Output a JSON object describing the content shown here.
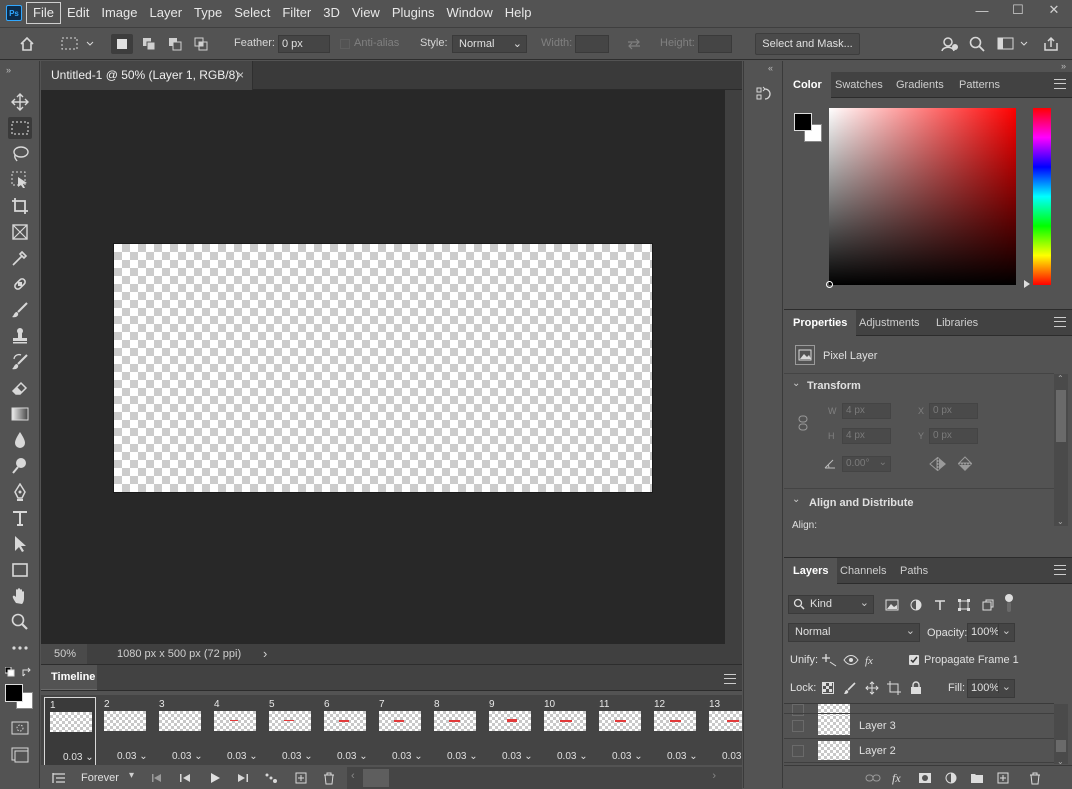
{
  "app": {
    "logo": "Ps"
  },
  "menu": [
    "File",
    "Edit",
    "Image",
    "Layer",
    "Type",
    "Select",
    "Filter",
    "3D",
    "View",
    "Plugins",
    "Window",
    "Help"
  ],
  "window_controls": {
    "minimize": "—",
    "restore": "☐",
    "close": "✕"
  },
  "options": {
    "feather_label": "Feather:",
    "feather_value": "0 px",
    "antialias_label": "Anti-alias",
    "style_label": "Style:",
    "style_value": "Normal",
    "width_label": "Width:",
    "height_label": "Height:",
    "select_mask_label": "Select and Mask..."
  },
  "document": {
    "tab_title": "Untitled-1 @ 50% (Layer 1, RGB/8)",
    "tab_close": "×",
    "zoom": "50%",
    "doc_info": "1080 px x 500 px (72 ppi)",
    "status_arrow": "›"
  },
  "timeline": {
    "title": "Timeline",
    "loop": "Forever",
    "frames": [
      {
        "num": "1",
        "delay": "0.03"
      },
      {
        "num": "2",
        "delay": "0.03"
      },
      {
        "num": "3",
        "delay": "0.03"
      },
      {
        "num": "4",
        "delay": "0.03"
      },
      {
        "num": "5",
        "delay": "0.03"
      },
      {
        "num": "6",
        "delay": "0.03"
      },
      {
        "num": "7",
        "delay": "0.03"
      },
      {
        "num": "8",
        "delay": "0.03"
      },
      {
        "num": "9",
        "delay": "0.03"
      },
      {
        "num": "10",
        "delay": "0.03"
      },
      {
        "num": "11",
        "delay": "0.03"
      },
      {
        "num": "12",
        "delay": "0.03"
      },
      {
        "num": "13",
        "delay": "0.03"
      }
    ],
    "selected_frame": "1"
  },
  "color_panel": {
    "tabs": [
      "Color",
      "Swatches",
      "Gradients",
      "Patterns"
    ],
    "active_tab": "Color",
    "foreground": "#000000",
    "background": "#ffffff",
    "hue_color": "#ff0000"
  },
  "properties_panel": {
    "tabs": [
      "Properties",
      "Adjustments",
      "Libraries"
    ],
    "active_tab": "Properties",
    "layer_type": "Pixel Layer",
    "transform_title": "Transform",
    "w_label": "W",
    "w_value": "4 px",
    "h_label": "H",
    "h_value": "4 px",
    "x_label": "X",
    "x_value": "0 px",
    "y_label": "Y",
    "y_value": "0 px",
    "angle_value": "0.00°",
    "align_title": "Align and Distribute",
    "align_label": "Align:"
  },
  "layers_panel": {
    "tabs": [
      "Layers",
      "Channels",
      "Paths"
    ],
    "active_tab": "Layers",
    "filter_kind": "Kind",
    "blend_mode": "Normal",
    "opacity_label": "Opacity:",
    "opacity_value": "100%",
    "unify_label": "Unify:",
    "propagate_label": "Propagate Frame 1",
    "lock_label": "Lock:",
    "fill_label": "Fill:",
    "fill_value": "100%",
    "layers": [
      {
        "name": "Layer 3"
      },
      {
        "name": "Layer 2"
      }
    ]
  },
  "colors": {
    "accent": "#31a8ff",
    "panel": "#535353",
    "dark": "#282828",
    "red": "#e23b3b"
  }
}
